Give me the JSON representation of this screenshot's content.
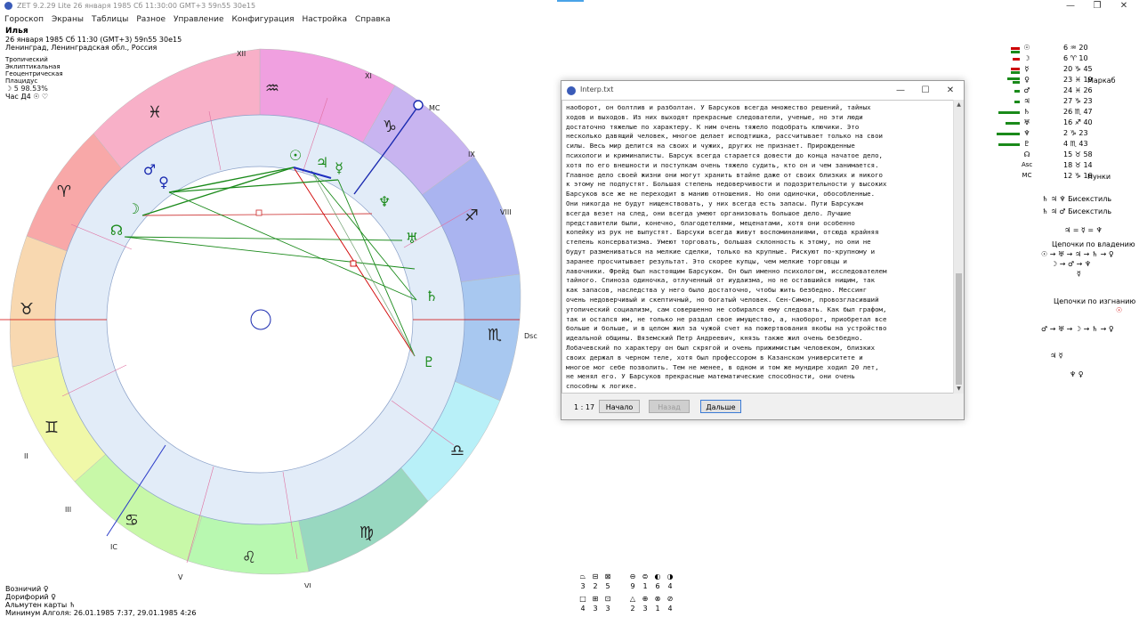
{
  "window": {
    "title": "ZET 9.2.29 Lite   26 января 1985  Сб  11:30:00 GMT+3 59n55  30e15",
    "minimize": "—",
    "maximize": "❐",
    "close": "✕"
  },
  "menu": [
    "Гороскоп",
    "Экраны",
    "Таблицы",
    "Разное",
    "Управление",
    "Конфигурация",
    "Настройка",
    "Справка"
  ],
  "person": {
    "name": "Илья",
    "datetime": "26 января 1985  Сб  11:30 (GMT+3) 59n55  30e15",
    "place": "Ленинград, Ленинградская обл., Россия",
    "settings": [
      "Тропический",
      "Эклиптикальная",
      "Геоцентрическая",
      "Плацидус"
    ],
    "moon_line": "☽  5  98.53%",
    "hour_line": "Час Д4 ☉ ♡"
  },
  "chart": {
    "houses": [
      "XII",
      "XI",
      "MC",
      "IX",
      "VIII",
      "Dsc",
      "VI",
      "V",
      "IC",
      "III",
      "II"
    ],
    "signs": [
      "♒",
      "♑",
      "♐",
      "♏",
      "♎",
      "♍",
      "♌",
      "♋",
      "♊",
      "♉",
      "♈",
      "♓"
    ],
    "planets": [
      "☉",
      "♃",
      "☿",
      "♂",
      "♀",
      "☽",
      "☊",
      "♆",
      "♅",
      "♄",
      "♇"
    ]
  },
  "bottom_info": {
    "line1": "Возничий  ♀",
    "line2": "Дорифорий  ♀",
    "line3": "Альмутен карты  ♄",
    "line4": "Минимум Алголя: 26.01.1985  7:37,  29.01.1985  4:26"
  },
  "interp": {
    "title": "Interp.txt",
    "text": "наоборот, он болтлив и разболтан. У Барсуков всегда множество решений, тайных\nходов и выходов. Из них выходят прекрасные следователи, ученые, но эти люди\nдостаточно тяжелые по характеру. К ним очень тяжело подобрать ключики. Это\nнесколько давящий человек, многое делает исподтишка, рассчитывает только на свои\nсилы. Весь мир делится на своих и чужих, других не признает. Прирожденные\nпсихологи и криминалисты. Барсук всегда старается довести до конца начатое дело,\nхотя по его внешности и поступкам очень тяжело судить, кто он и чем занимается.\nГлавное дело своей жизни они могут хранить втайне даже от своих близких и никого\nк этому не подпустят. Большая степень недоверчивости и подозрительности у высоких\nБарсуков все же не переходит в манию отношения. Но они одиночки, обособленные.\nОни никогда не будут нищенствовать, у них всегда есть запасы. Пути Барсукам\nвсегда везет на след, они всегда умеют организовать большое дело. Лучшие\nпредставители были, конечно, благодетелями, меценатами, хотя они особенно\nкопейку из рук не выпустят. Барсуки всегда живут воспоминаниями, отсюда крайняя\nстепень консерватизма. Умеют торговать, большая склонность к этому, но они не\nбудут размениваться на мелкие сделки, только на крупные. Рискуют по-крупному и\nзаранее просчитывает результат. Это скорее купцы, чем мелкие торговцы и\nлавочники. Фрейд был настоящим Барсуком. Он был именно психологом, исследователем\nтайного. Спиноза одиночка, отлученный от иудаизма, но не оставшийся нищим, так\nкак запасов, наследства у него было достаточно, чтобы жить безбедно. Мессинг\nочень недоверчивый и скептичный, но богатый человек. Сен-Симон, провозгласивший\nутопический социализм, сам совершенно не собирался ему следовать. Как был графом,\nтак и остался им, не только не раздал свое имущество, а, наоборот, приобретал все\nбольше и больше, и в целом жил за чужой счет на пожертвования якобы на устройство\nидеальной общины. Вяземский Петр Андреевич, князь также жил очень безбедно.\nЛобачевский по характеру он был скрягой и очень прижимистым человеком, близких\nсвоих держал в черном теле, хотя был профессором в Казанском университете и\nмногое мог себе позволить. Тем не менее, в одном и том же мундире ходил 20 лет,\nне менял его. У Барсуков прекрасные математические способности, они очень\nспособны к логике.",
    "counter": "1 : 17",
    "btn_start": "Начало",
    "btn_back": "Назад",
    "btn_next": "Дальше"
  },
  "planet_table": [
    {
      "glyph": "☉",
      "deg": "6",
      "sign": "♒",
      "min": "20",
      "bar": "#cc0000"
    },
    {
      "glyph": "☽",
      "deg": "6",
      "sign": "♈",
      "min": "10",
      "bar": "#cc0000"
    },
    {
      "glyph": "☿",
      "deg": "20",
      "sign": "♑",
      "min": "45",
      "bar": "#cc0000"
    },
    {
      "glyph": "♀",
      "deg": "23",
      "sign": "♓",
      "min": "19",
      "bar": "#1a8a1a"
    },
    {
      "glyph": "♂",
      "deg": "24",
      "sign": "♓",
      "min": "26",
      "bar": "#1a8a1a"
    },
    {
      "glyph": "♃",
      "deg": "27",
      "sign": "♑",
      "min": "23",
      "bar": "#1a8a1a"
    },
    {
      "glyph": "♄",
      "deg": "26",
      "sign": "♏",
      "min": "47",
      "bar": "#1a8a1a"
    },
    {
      "glyph": "♅",
      "deg": "16",
      "sign": "♐",
      "min": "40",
      "bar": "#1a8a1a"
    },
    {
      "glyph": "♆",
      "deg": "2",
      "sign": "♑",
      "min": "23",
      "bar": "#1a8a1a"
    },
    {
      "glyph": "♇",
      "deg": "4",
      "sign": "♏",
      "min": "43",
      "bar": "#1a8a1a"
    },
    {
      "glyph": "☊",
      "deg": "15",
      "sign": "♉",
      "min": "58",
      "bar": ""
    },
    {
      "glyph": "Asc",
      "deg": "18",
      "sign": "♉",
      "min": "14",
      "bar": ""
    },
    {
      "glyph": "MC",
      "deg": "12",
      "sign": "♑",
      "min": "16",
      "bar": ""
    }
  ],
  "right_labels": {
    "markab": "Маркаб",
    "nunki": "Нунки",
    "biquintile1": "♄ ♃ ♆  Бисекстиль",
    "biquintile2": "♄ ♃ ♂  Бисекстиль",
    "equation": "♃ = ☿ = ♆",
    "chains_owner_title": "Цепочки по владению",
    "chains_owner_1": "☉ → ♅ → ♃ → ♄ → ♀",
    "chains_owner_2": "☽ → ♂ → ♆",
    "chains_owner_3": "☿",
    "chains_exile_title": "Цепочки по изгнанию",
    "chains_exile_mark": "☉",
    "chains_exile_1": "♂ → ♅ → ☽ → ♄ → ♀",
    "chains_exile_2": "♃        ☿",
    "chains_exile_3": "♆        ♀"
  },
  "bottom_grid": {
    "row1_icons": [
      "⏢",
      "⊟",
      "⊠",
      "⊖",
      "⊜",
      "◐",
      "◑"
    ],
    "row1_nums": [
      "3",
      "2",
      "5",
      "9",
      "1",
      "6",
      "4"
    ],
    "row2_icons": [
      "□",
      "⊞",
      "⊡",
      "△",
      "⊕",
      "⊗",
      "⊘"
    ],
    "row2_nums": [
      "4",
      "3",
      "3",
      "2",
      "3",
      "1",
      "4"
    ]
  }
}
